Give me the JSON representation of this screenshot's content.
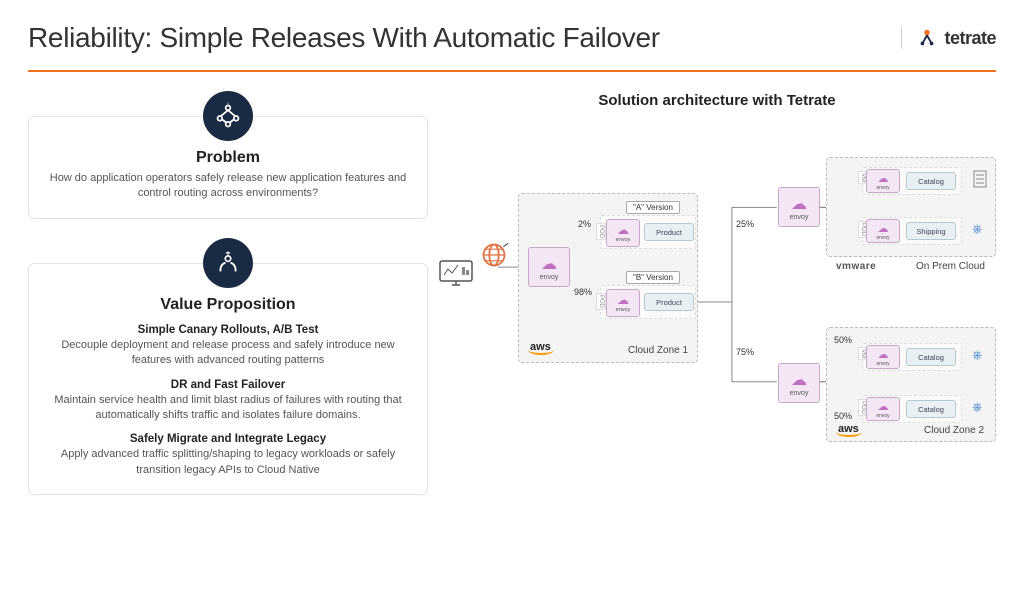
{
  "header": {
    "title": "Reliability: Simple Releases With Automatic Failover",
    "logo_text": "tetrate"
  },
  "left": {
    "problem": {
      "title": "Problem",
      "text": "How do application operators safely release new application features and control routing across environments?"
    },
    "value": {
      "title": "Value Proposition",
      "items": [
        {
          "subtitle": "Simple Canary Rollouts, A/B Test",
          "text": "Decouple deployment and release process and safely introduce new features with advanced routing patterns"
        },
        {
          "subtitle": "DR and Fast Failover",
          "text": "Maintain service health and limit blast radius of failures with routing that automatically shifts traffic and isolates failure domains."
        },
        {
          "subtitle": "Safely Migrate and Integrate Legacy",
          "text": "Apply advanced traffic splitting/shaping to legacy workloads or safely transition legacy APIs to Cloud Native"
        }
      ]
    }
  },
  "right": {
    "title": "Solution architecture with Tetrate",
    "envoy": "envoy",
    "version_a": "\"A\" Version",
    "version_b": "\"B\" Version",
    "svc_product": "Product",
    "svc_catalog": "Catalog",
    "svc_shipping": "Shipping",
    "pct_2": "2%",
    "pct_98": "98%",
    "pct_25": "25%",
    "pct_75": "75%",
    "pct_50a": "50%",
    "pct_50b": "50%",
    "zone1": "Cloud Zone 1",
    "zone2": "Cloud Zone 2",
    "onprem": "On Prem Cloud",
    "aws": "aws",
    "vmware": "vmware",
    "pod": "POD",
    "vm": "VM"
  }
}
